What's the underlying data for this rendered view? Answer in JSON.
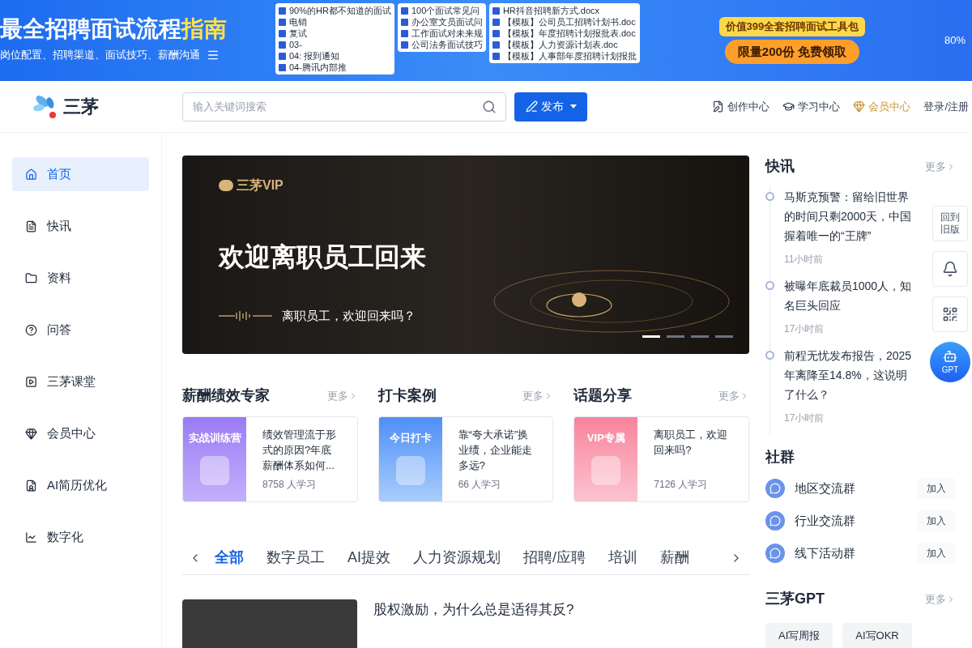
{
  "ad_banner": {
    "title": "最全招聘面试流程",
    "title_highlight": "指南",
    "subtitle": "岗位配置、招聘渠道、面试技巧、薪酬沟通",
    "doc_columns": [
      [
        "90%的HR都不知道的面试",
        "电销",
        "复试",
        "03-",
        "04: 报到通知",
        "04-腾讯内部推"
      ],
      [
        "100个面试常见问",
        "办公室文员面试问",
        "工作面试对未来规",
        "公司法务面试技巧"
      ],
      [
        "HR抖音招聘新方式.docx",
        "【模板】公司员工招聘计划书.doc",
        "【模板】年度招聘计划报批表.doc",
        "【模板】人力资源计划表.doc",
        "【模板】人事部年度招聘计划报批"
      ]
    ],
    "promo_top": "价值399全套招聘面试工具包",
    "promo_bottom": "限量200份 免费领取",
    "percent": "80%"
  },
  "header": {
    "logo": "三茅",
    "search": {
      "placeholder": "输入关键词搜索"
    },
    "publish": "发布",
    "links": [
      {
        "label": "创作中心",
        "kind": "create",
        "selected": false
      },
      {
        "label": "学习中心",
        "kind": "learn",
        "selected": false
      },
      {
        "label": "会员中心",
        "kind": "vip",
        "selected": true
      },
      {
        "label": "登录/注册",
        "kind": "login",
        "selected": false
      }
    ]
  },
  "sidebar": {
    "items": [
      {
        "label": "首页",
        "selected": true
      },
      {
        "label": "快讯",
        "selected": false
      },
      {
        "label": "资料",
        "selected": false
      },
      {
        "label": "问答",
        "selected": false
      },
      {
        "label": "三茅课堂",
        "selected": false
      },
      {
        "label": "会员中心",
        "selected": false
      },
      {
        "label": "AI简历优化",
        "selected": false
      },
      {
        "label": "数字化",
        "selected": false
      }
    ]
  },
  "hero": {
    "brand": "三茅VIP",
    "headline": "欢迎离职员工回来",
    "subline": "离职员工，欢迎回来吗？",
    "slides": [
      {
        "selected": true
      },
      {
        "selected": false
      },
      {
        "selected": false
      },
      {
        "selected": false
      }
    ]
  },
  "sections": [
    {
      "title": "薪酬绩效专家",
      "more": "更多",
      "card": {
        "thumb_label": "实战训练营",
        "title": "绩效管理流于形式的原因?年底薪酬体系如何...",
        "learners": "8758 人学习"
      }
    },
    {
      "title": "打卡案例",
      "more": "更多",
      "card": {
        "thumb_label": "今日打卡",
        "title": "靠“夸大承诺”换业绩，企业能走多远?",
        "learners": "66 人学习"
      }
    },
    {
      "title": "话题分享",
      "more": "更多",
      "card": {
        "thumb_label": "VIP专属",
        "title": "离职员工，欢迎回来吗?",
        "learners": "7126 人学习"
      }
    }
  ],
  "category_tabs": [
    {
      "label": "全部",
      "selected": true
    },
    {
      "label": "数字员工",
      "selected": false
    },
    {
      "label": "AI提效",
      "selected": false
    },
    {
      "label": "人力资源规划",
      "selected": false
    },
    {
      "label": "招聘/应聘",
      "selected": false
    },
    {
      "label": "培训",
      "selected": false
    },
    {
      "label": "薪酬",
      "selected": false
    }
  ],
  "article": {
    "title": "股权激励，为什么总是适得其反?"
  },
  "news": {
    "title": "快讯",
    "more": "更多",
    "items": [
      {
        "title": "马斯克预警：留给旧世界的时间只剩2000天，中国握着唯一的“王牌”",
        "time": "11小时前"
      },
      {
        "title": "被曝年底裁员1000人，知名巨头回应",
        "time": "17小时前"
      },
      {
        "title": "前程无忧发布报告，2025年离降至14.8%，这说明了什么？",
        "time": "17小时前"
      }
    ]
  },
  "float_tools": [
    {
      "kind": "old",
      "label": "回到旧版"
    },
    {
      "kind": "bell"
    },
    {
      "kind": "qr"
    },
    {
      "kind": "gpt",
      "label": "GPT"
    }
  ],
  "groups": {
    "title": "社群",
    "items": [
      {
        "name": "地区交流群",
        "action": "加入"
      },
      {
        "name": "行业交流群",
        "action": "加入"
      },
      {
        "name": "线下活动群",
        "action": "加入"
      }
    ]
  },
  "gpt": {
    "title": "三茅GPT",
    "more": "更多",
    "buttons": [
      "AI写周报",
      "AI写OKR"
    ]
  }
}
